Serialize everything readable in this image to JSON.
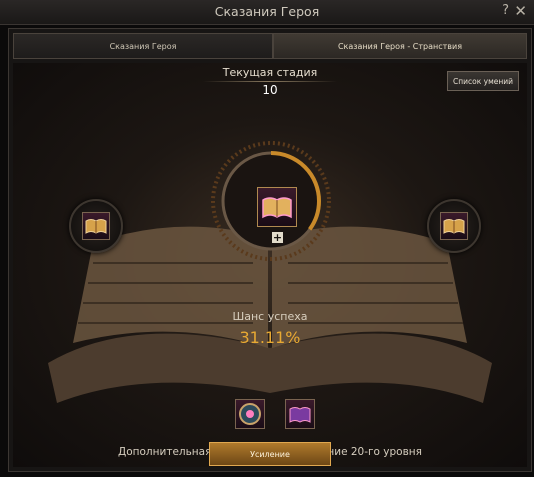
{
  "window": {
    "title": "Сказания Героя",
    "help": "?",
    "close": "✕"
  },
  "tabs": [
    {
      "label": "Сказания Героя"
    },
    {
      "label": "Сказания Героя - Странствия"
    }
  ],
  "stage": {
    "label": "Текущая стадия",
    "value": "10"
  },
  "skills_button": "Список умений",
  "center": {
    "plus": "+",
    "progress": 0.35
  },
  "chance": {
    "label": "Шанс успеха",
    "value": "31.11%"
  },
  "bonus_text": "Дополнительная награда за достижение 20-го уровня",
  "upgrade_button": "Усиление",
  "colors": {
    "accent": "#e8a933",
    "ring": "#c98a2a"
  },
  "icons": [
    "book-icon",
    "book-icon",
    "book-icon",
    "reward-orb-icon",
    "reward-book-icon"
  ]
}
